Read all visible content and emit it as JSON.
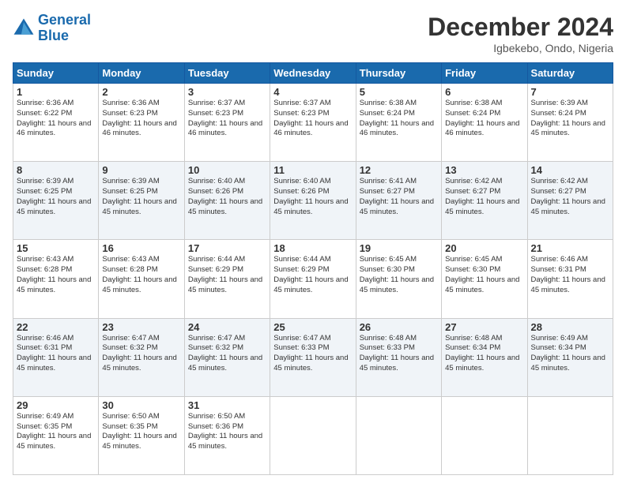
{
  "logo": {
    "line1": "General",
    "line2": "Blue"
  },
  "title": "December 2024",
  "location": "Igbekebo, Ondo, Nigeria",
  "days_header": [
    "Sunday",
    "Monday",
    "Tuesday",
    "Wednesday",
    "Thursday",
    "Friday",
    "Saturday"
  ],
  "weeks": [
    [
      {
        "day": "1",
        "sunrise": "6:36 AM",
        "sunset": "6:22 PM",
        "daylight": "11 hours and 46 minutes."
      },
      {
        "day": "2",
        "sunrise": "6:36 AM",
        "sunset": "6:23 PM",
        "daylight": "11 hours and 46 minutes."
      },
      {
        "day": "3",
        "sunrise": "6:37 AM",
        "sunset": "6:23 PM",
        "daylight": "11 hours and 46 minutes."
      },
      {
        "day": "4",
        "sunrise": "6:37 AM",
        "sunset": "6:23 PM",
        "daylight": "11 hours and 46 minutes."
      },
      {
        "day": "5",
        "sunrise": "6:38 AM",
        "sunset": "6:24 PM",
        "daylight": "11 hours and 46 minutes."
      },
      {
        "day": "6",
        "sunrise": "6:38 AM",
        "sunset": "6:24 PM",
        "daylight": "11 hours and 46 minutes."
      },
      {
        "day": "7",
        "sunrise": "6:39 AM",
        "sunset": "6:24 PM",
        "daylight": "11 hours and 45 minutes."
      }
    ],
    [
      {
        "day": "8",
        "sunrise": "6:39 AM",
        "sunset": "6:25 PM",
        "daylight": "11 hours and 45 minutes."
      },
      {
        "day": "9",
        "sunrise": "6:39 AM",
        "sunset": "6:25 PM",
        "daylight": "11 hours and 45 minutes."
      },
      {
        "day": "10",
        "sunrise": "6:40 AM",
        "sunset": "6:26 PM",
        "daylight": "11 hours and 45 minutes."
      },
      {
        "day": "11",
        "sunrise": "6:40 AM",
        "sunset": "6:26 PM",
        "daylight": "11 hours and 45 minutes."
      },
      {
        "day": "12",
        "sunrise": "6:41 AM",
        "sunset": "6:27 PM",
        "daylight": "11 hours and 45 minutes."
      },
      {
        "day": "13",
        "sunrise": "6:42 AM",
        "sunset": "6:27 PM",
        "daylight": "11 hours and 45 minutes."
      },
      {
        "day": "14",
        "sunrise": "6:42 AM",
        "sunset": "6:27 PM",
        "daylight": "11 hours and 45 minutes."
      }
    ],
    [
      {
        "day": "15",
        "sunrise": "6:43 AM",
        "sunset": "6:28 PM",
        "daylight": "11 hours and 45 minutes."
      },
      {
        "day": "16",
        "sunrise": "6:43 AM",
        "sunset": "6:28 PM",
        "daylight": "11 hours and 45 minutes."
      },
      {
        "day": "17",
        "sunrise": "6:44 AM",
        "sunset": "6:29 PM",
        "daylight": "11 hours and 45 minutes."
      },
      {
        "day": "18",
        "sunrise": "6:44 AM",
        "sunset": "6:29 PM",
        "daylight": "11 hours and 45 minutes."
      },
      {
        "day": "19",
        "sunrise": "6:45 AM",
        "sunset": "6:30 PM",
        "daylight": "11 hours and 45 minutes."
      },
      {
        "day": "20",
        "sunrise": "6:45 AM",
        "sunset": "6:30 PM",
        "daylight": "11 hours and 45 minutes."
      },
      {
        "day": "21",
        "sunrise": "6:46 AM",
        "sunset": "6:31 PM",
        "daylight": "11 hours and 45 minutes."
      }
    ],
    [
      {
        "day": "22",
        "sunrise": "6:46 AM",
        "sunset": "6:31 PM",
        "daylight": "11 hours and 45 minutes."
      },
      {
        "day": "23",
        "sunrise": "6:47 AM",
        "sunset": "6:32 PM",
        "daylight": "11 hours and 45 minutes."
      },
      {
        "day": "24",
        "sunrise": "6:47 AM",
        "sunset": "6:32 PM",
        "daylight": "11 hours and 45 minutes."
      },
      {
        "day": "25",
        "sunrise": "6:47 AM",
        "sunset": "6:33 PM",
        "daylight": "11 hours and 45 minutes."
      },
      {
        "day": "26",
        "sunrise": "6:48 AM",
        "sunset": "6:33 PM",
        "daylight": "11 hours and 45 minutes."
      },
      {
        "day": "27",
        "sunrise": "6:48 AM",
        "sunset": "6:34 PM",
        "daylight": "11 hours and 45 minutes."
      },
      {
        "day": "28",
        "sunrise": "6:49 AM",
        "sunset": "6:34 PM",
        "daylight": "11 hours and 45 minutes."
      }
    ],
    [
      {
        "day": "29",
        "sunrise": "6:49 AM",
        "sunset": "6:35 PM",
        "daylight": "11 hours and 45 minutes."
      },
      {
        "day": "30",
        "sunrise": "6:50 AM",
        "sunset": "6:35 PM",
        "daylight": "11 hours and 45 minutes."
      },
      {
        "day": "31",
        "sunrise": "6:50 AM",
        "sunset": "6:36 PM",
        "daylight": "11 hours and 45 minutes."
      },
      null,
      null,
      null,
      null
    ]
  ]
}
